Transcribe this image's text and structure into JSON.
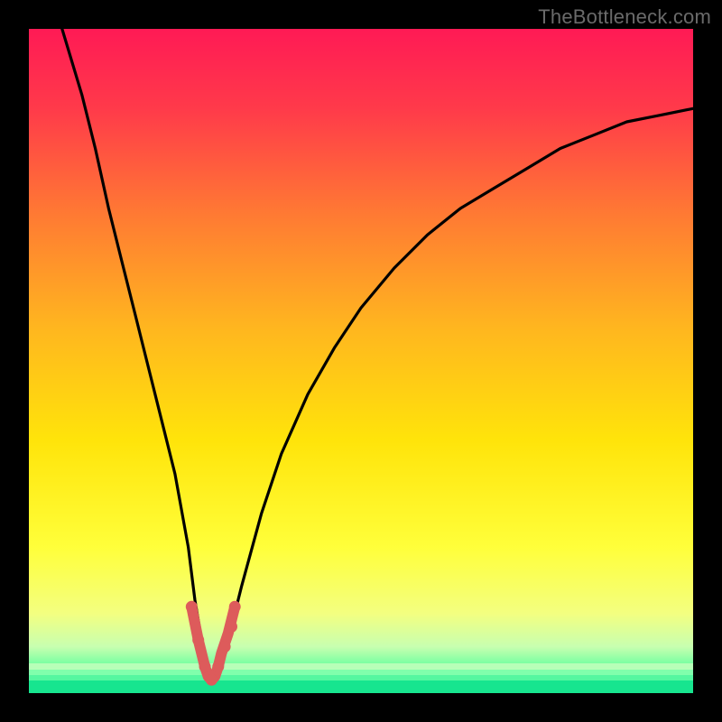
{
  "watermark": "TheBottleneck.com",
  "colors": {
    "frame": "#000000",
    "gradient_stops": [
      {
        "offset": 0.0,
        "color": "#ff1a55"
      },
      {
        "offset": 0.12,
        "color": "#ff3a4a"
      },
      {
        "offset": 0.28,
        "color": "#ff7a33"
      },
      {
        "offset": 0.45,
        "color": "#ffb61f"
      },
      {
        "offset": 0.62,
        "color": "#ffe40a"
      },
      {
        "offset": 0.78,
        "color": "#ffff3a"
      },
      {
        "offset": 0.88,
        "color": "#f3ff80"
      },
      {
        "offset": 0.93,
        "color": "#c8ffb0"
      },
      {
        "offset": 0.97,
        "color": "#4fff9a"
      },
      {
        "offset": 1.0,
        "color": "#00e58a"
      }
    ],
    "green_bands": [
      {
        "y": 0.955,
        "h": 0.01,
        "color": "#b8ffb8"
      },
      {
        "y": 0.965,
        "h": 0.008,
        "color": "#80ffac"
      },
      {
        "y": 0.973,
        "h": 0.008,
        "color": "#55f7a0"
      },
      {
        "y": 0.981,
        "h": 0.019,
        "color": "#17e58f"
      }
    ],
    "curve_stroke": "#000000",
    "highlight_stroke": "#dd5b5b"
  },
  "chart_data": {
    "type": "line",
    "title": "",
    "xlabel": "",
    "ylabel": "",
    "xlim": [
      0,
      100
    ],
    "ylim": [
      0,
      100
    ],
    "note": "Axes have no tick labels; x and y are normalized 0–100 from the visible plot area. Curve values estimated from pixel positions.",
    "series": [
      {
        "name": "bottleneck-curve",
        "x": [
          5,
          8,
          10,
          12,
          14,
          16,
          18,
          20,
          22,
          24,
          25,
          26,
          27,
          28,
          29,
          30,
          32,
          35,
          38,
          42,
          46,
          50,
          55,
          60,
          65,
          70,
          75,
          80,
          85,
          90,
          95,
          100
        ],
        "y": [
          100,
          90,
          82,
          73,
          65,
          57,
          49,
          41,
          33,
          22,
          14,
          8,
          4,
          2,
          4,
          8,
          16,
          27,
          36,
          45,
          52,
          58,
          64,
          69,
          73,
          76,
          79,
          82,
          84,
          86,
          87,
          88
        ]
      },
      {
        "name": "highlight-segment",
        "x": [
          24.5,
          25.5,
          26.5,
          27,
          27.5,
          28,
          28.5,
          29,
          30,
          31
        ],
        "y": [
          13,
          8,
          4,
          2.5,
          2,
          2.5,
          4,
          6,
          9,
          13
        ]
      }
    ],
    "highlight_dots": {
      "x": [
        24.5,
        25.5,
        26.5,
        27.5,
        28.5,
        29.5,
        30.5,
        31
      ],
      "y": [
        13,
        8,
        4,
        2,
        4,
        7,
        10,
        13
      ]
    }
  }
}
